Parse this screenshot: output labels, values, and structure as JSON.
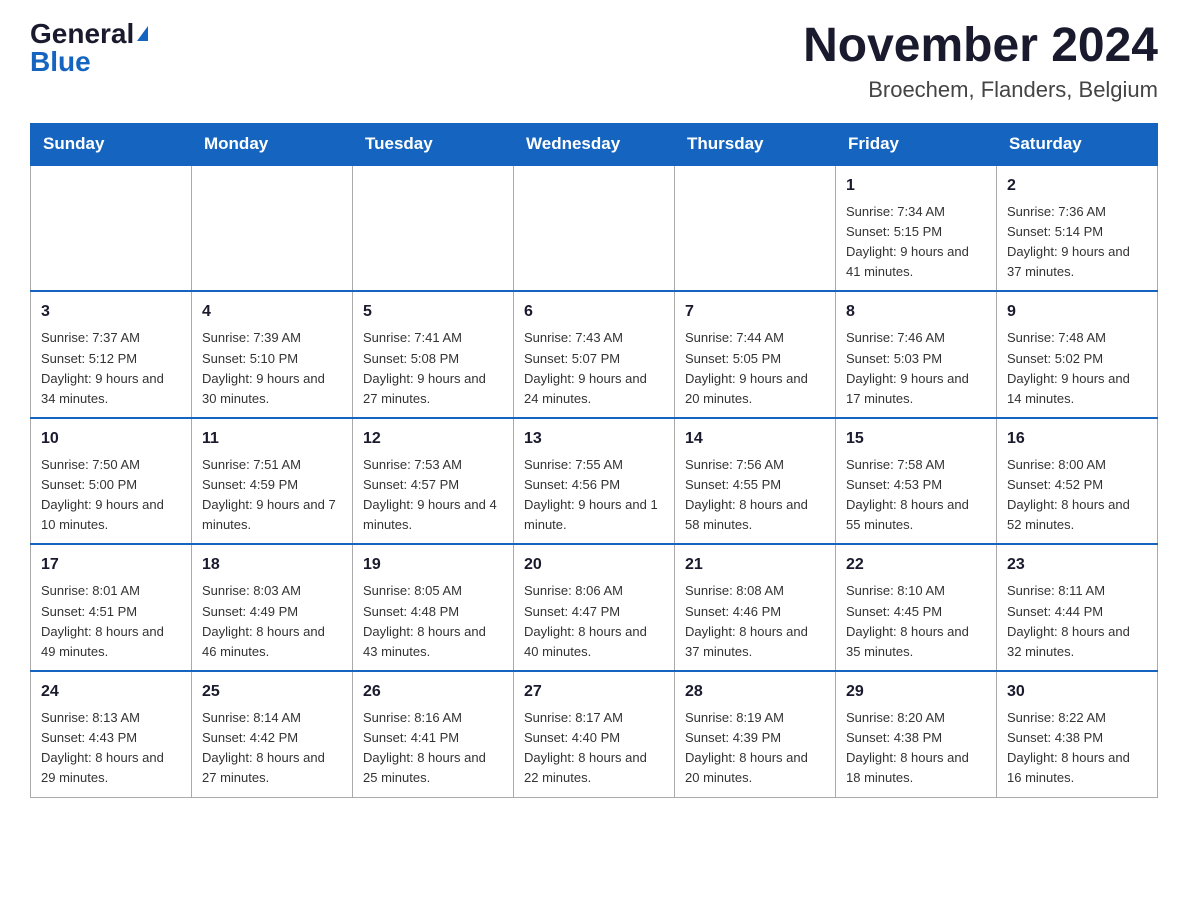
{
  "logo": {
    "text_general": "General",
    "triangle": "▶",
    "text_blue": "Blue"
  },
  "header": {
    "month_year": "November 2024",
    "location": "Broechem, Flanders, Belgium"
  },
  "days_of_week": [
    "Sunday",
    "Monday",
    "Tuesday",
    "Wednesday",
    "Thursday",
    "Friday",
    "Saturday"
  ],
  "weeks": [
    [
      {
        "day": "",
        "sunrise": "",
        "sunset": "",
        "daylight": ""
      },
      {
        "day": "",
        "sunrise": "",
        "sunset": "",
        "daylight": ""
      },
      {
        "day": "",
        "sunrise": "",
        "sunset": "",
        "daylight": ""
      },
      {
        "day": "",
        "sunrise": "",
        "sunset": "",
        "daylight": ""
      },
      {
        "day": "",
        "sunrise": "",
        "sunset": "",
        "daylight": ""
      },
      {
        "day": "1",
        "sunrise": "Sunrise: 7:34 AM",
        "sunset": "Sunset: 5:15 PM",
        "daylight": "Daylight: 9 hours and 41 minutes."
      },
      {
        "day": "2",
        "sunrise": "Sunrise: 7:36 AM",
        "sunset": "Sunset: 5:14 PM",
        "daylight": "Daylight: 9 hours and 37 minutes."
      }
    ],
    [
      {
        "day": "3",
        "sunrise": "Sunrise: 7:37 AM",
        "sunset": "Sunset: 5:12 PM",
        "daylight": "Daylight: 9 hours and 34 minutes."
      },
      {
        "day": "4",
        "sunrise": "Sunrise: 7:39 AM",
        "sunset": "Sunset: 5:10 PM",
        "daylight": "Daylight: 9 hours and 30 minutes."
      },
      {
        "day": "5",
        "sunrise": "Sunrise: 7:41 AM",
        "sunset": "Sunset: 5:08 PM",
        "daylight": "Daylight: 9 hours and 27 minutes."
      },
      {
        "day": "6",
        "sunrise": "Sunrise: 7:43 AM",
        "sunset": "Sunset: 5:07 PM",
        "daylight": "Daylight: 9 hours and 24 minutes."
      },
      {
        "day": "7",
        "sunrise": "Sunrise: 7:44 AM",
        "sunset": "Sunset: 5:05 PM",
        "daylight": "Daylight: 9 hours and 20 minutes."
      },
      {
        "day": "8",
        "sunrise": "Sunrise: 7:46 AM",
        "sunset": "Sunset: 5:03 PM",
        "daylight": "Daylight: 9 hours and 17 minutes."
      },
      {
        "day": "9",
        "sunrise": "Sunrise: 7:48 AM",
        "sunset": "Sunset: 5:02 PM",
        "daylight": "Daylight: 9 hours and 14 minutes."
      }
    ],
    [
      {
        "day": "10",
        "sunrise": "Sunrise: 7:50 AM",
        "sunset": "Sunset: 5:00 PM",
        "daylight": "Daylight: 9 hours and 10 minutes."
      },
      {
        "day": "11",
        "sunrise": "Sunrise: 7:51 AM",
        "sunset": "Sunset: 4:59 PM",
        "daylight": "Daylight: 9 hours and 7 minutes."
      },
      {
        "day": "12",
        "sunrise": "Sunrise: 7:53 AM",
        "sunset": "Sunset: 4:57 PM",
        "daylight": "Daylight: 9 hours and 4 minutes."
      },
      {
        "day": "13",
        "sunrise": "Sunrise: 7:55 AM",
        "sunset": "Sunset: 4:56 PM",
        "daylight": "Daylight: 9 hours and 1 minute."
      },
      {
        "day": "14",
        "sunrise": "Sunrise: 7:56 AM",
        "sunset": "Sunset: 4:55 PM",
        "daylight": "Daylight: 8 hours and 58 minutes."
      },
      {
        "day": "15",
        "sunrise": "Sunrise: 7:58 AM",
        "sunset": "Sunset: 4:53 PM",
        "daylight": "Daylight: 8 hours and 55 minutes."
      },
      {
        "day": "16",
        "sunrise": "Sunrise: 8:00 AM",
        "sunset": "Sunset: 4:52 PM",
        "daylight": "Daylight: 8 hours and 52 minutes."
      }
    ],
    [
      {
        "day": "17",
        "sunrise": "Sunrise: 8:01 AM",
        "sunset": "Sunset: 4:51 PM",
        "daylight": "Daylight: 8 hours and 49 minutes."
      },
      {
        "day": "18",
        "sunrise": "Sunrise: 8:03 AM",
        "sunset": "Sunset: 4:49 PM",
        "daylight": "Daylight: 8 hours and 46 minutes."
      },
      {
        "day": "19",
        "sunrise": "Sunrise: 8:05 AM",
        "sunset": "Sunset: 4:48 PM",
        "daylight": "Daylight: 8 hours and 43 minutes."
      },
      {
        "day": "20",
        "sunrise": "Sunrise: 8:06 AM",
        "sunset": "Sunset: 4:47 PM",
        "daylight": "Daylight: 8 hours and 40 minutes."
      },
      {
        "day": "21",
        "sunrise": "Sunrise: 8:08 AM",
        "sunset": "Sunset: 4:46 PM",
        "daylight": "Daylight: 8 hours and 37 minutes."
      },
      {
        "day": "22",
        "sunrise": "Sunrise: 8:10 AM",
        "sunset": "Sunset: 4:45 PM",
        "daylight": "Daylight: 8 hours and 35 minutes."
      },
      {
        "day": "23",
        "sunrise": "Sunrise: 8:11 AM",
        "sunset": "Sunset: 4:44 PM",
        "daylight": "Daylight: 8 hours and 32 minutes."
      }
    ],
    [
      {
        "day": "24",
        "sunrise": "Sunrise: 8:13 AM",
        "sunset": "Sunset: 4:43 PM",
        "daylight": "Daylight: 8 hours and 29 minutes."
      },
      {
        "day": "25",
        "sunrise": "Sunrise: 8:14 AM",
        "sunset": "Sunset: 4:42 PM",
        "daylight": "Daylight: 8 hours and 27 minutes."
      },
      {
        "day": "26",
        "sunrise": "Sunrise: 8:16 AM",
        "sunset": "Sunset: 4:41 PM",
        "daylight": "Daylight: 8 hours and 25 minutes."
      },
      {
        "day": "27",
        "sunrise": "Sunrise: 8:17 AM",
        "sunset": "Sunset: 4:40 PM",
        "daylight": "Daylight: 8 hours and 22 minutes."
      },
      {
        "day": "28",
        "sunrise": "Sunrise: 8:19 AM",
        "sunset": "Sunset: 4:39 PM",
        "daylight": "Daylight: 8 hours and 20 minutes."
      },
      {
        "day": "29",
        "sunrise": "Sunrise: 8:20 AM",
        "sunset": "Sunset: 4:38 PM",
        "daylight": "Daylight: 8 hours and 18 minutes."
      },
      {
        "day": "30",
        "sunrise": "Sunrise: 8:22 AM",
        "sunset": "Sunset: 4:38 PM",
        "daylight": "Daylight: 8 hours and 16 minutes."
      }
    ]
  ]
}
